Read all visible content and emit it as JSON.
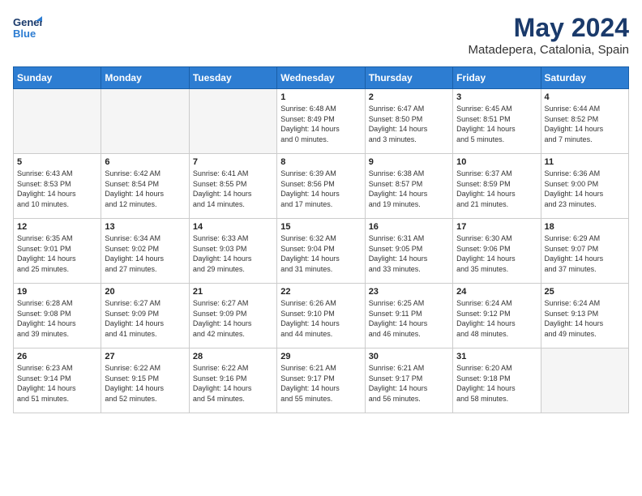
{
  "header": {
    "logo_line1": "General",
    "logo_line2": "Blue",
    "month_year": "May 2024",
    "location": "Matadepera, Catalonia, Spain"
  },
  "weekdays": [
    "Sunday",
    "Monday",
    "Tuesday",
    "Wednesday",
    "Thursday",
    "Friday",
    "Saturday"
  ],
  "weeks": [
    [
      {
        "day": "",
        "info": ""
      },
      {
        "day": "",
        "info": ""
      },
      {
        "day": "",
        "info": ""
      },
      {
        "day": "1",
        "info": "Sunrise: 6:48 AM\nSunset: 8:49 PM\nDaylight: 14 hours\nand 0 minutes."
      },
      {
        "day": "2",
        "info": "Sunrise: 6:47 AM\nSunset: 8:50 PM\nDaylight: 14 hours\nand 3 minutes."
      },
      {
        "day": "3",
        "info": "Sunrise: 6:45 AM\nSunset: 8:51 PM\nDaylight: 14 hours\nand 5 minutes."
      },
      {
        "day": "4",
        "info": "Sunrise: 6:44 AM\nSunset: 8:52 PM\nDaylight: 14 hours\nand 7 minutes."
      }
    ],
    [
      {
        "day": "5",
        "info": "Sunrise: 6:43 AM\nSunset: 8:53 PM\nDaylight: 14 hours\nand 10 minutes."
      },
      {
        "day": "6",
        "info": "Sunrise: 6:42 AM\nSunset: 8:54 PM\nDaylight: 14 hours\nand 12 minutes."
      },
      {
        "day": "7",
        "info": "Sunrise: 6:41 AM\nSunset: 8:55 PM\nDaylight: 14 hours\nand 14 minutes."
      },
      {
        "day": "8",
        "info": "Sunrise: 6:39 AM\nSunset: 8:56 PM\nDaylight: 14 hours\nand 17 minutes."
      },
      {
        "day": "9",
        "info": "Sunrise: 6:38 AM\nSunset: 8:57 PM\nDaylight: 14 hours\nand 19 minutes."
      },
      {
        "day": "10",
        "info": "Sunrise: 6:37 AM\nSunset: 8:59 PM\nDaylight: 14 hours\nand 21 minutes."
      },
      {
        "day": "11",
        "info": "Sunrise: 6:36 AM\nSunset: 9:00 PM\nDaylight: 14 hours\nand 23 minutes."
      }
    ],
    [
      {
        "day": "12",
        "info": "Sunrise: 6:35 AM\nSunset: 9:01 PM\nDaylight: 14 hours\nand 25 minutes."
      },
      {
        "day": "13",
        "info": "Sunrise: 6:34 AM\nSunset: 9:02 PM\nDaylight: 14 hours\nand 27 minutes."
      },
      {
        "day": "14",
        "info": "Sunrise: 6:33 AM\nSunset: 9:03 PM\nDaylight: 14 hours\nand 29 minutes."
      },
      {
        "day": "15",
        "info": "Sunrise: 6:32 AM\nSunset: 9:04 PM\nDaylight: 14 hours\nand 31 minutes."
      },
      {
        "day": "16",
        "info": "Sunrise: 6:31 AM\nSunset: 9:05 PM\nDaylight: 14 hours\nand 33 minutes."
      },
      {
        "day": "17",
        "info": "Sunrise: 6:30 AM\nSunset: 9:06 PM\nDaylight: 14 hours\nand 35 minutes."
      },
      {
        "day": "18",
        "info": "Sunrise: 6:29 AM\nSunset: 9:07 PM\nDaylight: 14 hours\nand 37 minutes."
      }
    ],
    [
      {
        "day": "19",
        "info": "Sunrise: 6:28 AM\nSunset: 9:08 PM\nDaylight: 14 hours\nand 39 minutes."
      },
      {
        "day": "20",
        "info": "Sunrise: 6:27 AM\nSunset: 9:09 PM\nDaylight: 14 hours\nand 41 minutes."
      },
      {
        "day": "21",
        "info": "Sunrise: 6:27 AM\nSunset: 9:09 PM\nDaylight: 14 hours\nand 42 minutes."
      },
      {
        "day": "22",
        "info": "Sunrise: 6:26 AM\nSunset: 9:10 PM\nDaylight: 14 hours\nand 44 minutes."
      },
      {
        "day": "23",
        "info": "Sunrise: 6:25 AM\nSunset: 9:11 PM\nDaylight: 14 hours\nand 46 minutes."
      },
      {
        "day": "24",
        "info": "Sunrise: 6:24 AM\nSunset: 9:12 PM\nDaylight: 14 hours\nand 48 minutes."
      },
      {
        "day": "25",
        "info": "Sunrise: 6:24 AM\nSunset: 9:13 PM\nDaylight: 14 hours\nand 49 minutes."
      }
    ],
    [
      {
        "day": "26",
        "info": "Sunrise: 6:23 AM\nSunset: 9:14 PM\nDaylight: 14 hours\nand 51 minutes."
      },
      {
        "day": "27",
        "info": "Sunrise: 6:22 AM\nSunset: 9:15 PM\nDaylight: 14 hours\nand 52 minutes."
      },
      {
        "day": "28",
        "info": "Sunrise: 6:22 AM\nSunset: 9:16 PM\nDaylight: 14 hours\nand 54 minutes."
      },
      {
        "day": "29",
        "info": "Sunrise: 6:21 AM\nSunset: 9:17 PM\nDaylight: 14 hours\nand 55 minutes."
      },
      {
        "day": "30",
        "info": "Sunrise: 6:21 AM\nSunset: 9:17 PM\nDaylight: 14 hours\nand 56 minutes."
      },
      {
        "day": "31",
        "info": "Sunrise: 6:20 AM\nSunset: 9:18 PM\nDaylight: 14 hours\nand 58 minutes."
      },
      {
        "day": "",
        "info": ""
      }
    ]
  ]
}
